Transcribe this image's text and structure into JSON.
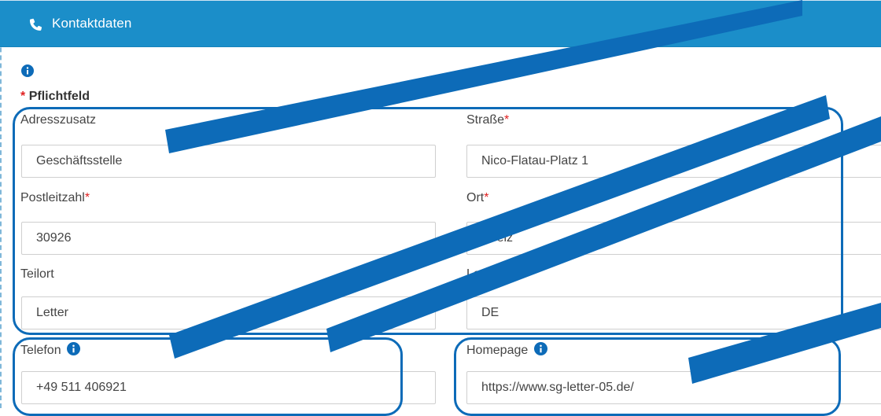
{
  "header": {
    "title": "Kontaktdaten",
    "icon": "phone-icon",
    "background": "#1b8ec9"
  },
  "form": {
    "required_star": "*",
    "required_note": "Pflichtfeld",
    "fields": {
      "adresszusatz": {
        "label": "Adresszusatz",
        "value": "Geschäftsstelle"
      },
      "strasse": {
        "label": "Straße",
        "required": "*",
        "value": "Nico-Flatau-Platz 1"
      },
      "postleitzahl": {
        "label": "Postleitzahl",
        "required": "*",
        "value": "30926"
      },
      "ort": {
        "label": "Ort",
        "required": "*",
        "value": "Seelz"
      },
      "teilort": {
        "label": "Teilort",
        "value": "Letter"
      },
      "land": {
        "label": "Land",
        "value": "DE"
      },
      "telefon": {
        "label": "Telefon",
        "value": "+49 511 406921",
        "icon": "info-icon"
      },
      "homepage": {
        "label": "Homepage",
        "value": "https://www.sg-letter-05.de/",
        "icon": "info-icon"
      }
    }
  },
  "annotations": {
    "color": "#0d6bb8"
  }
}
